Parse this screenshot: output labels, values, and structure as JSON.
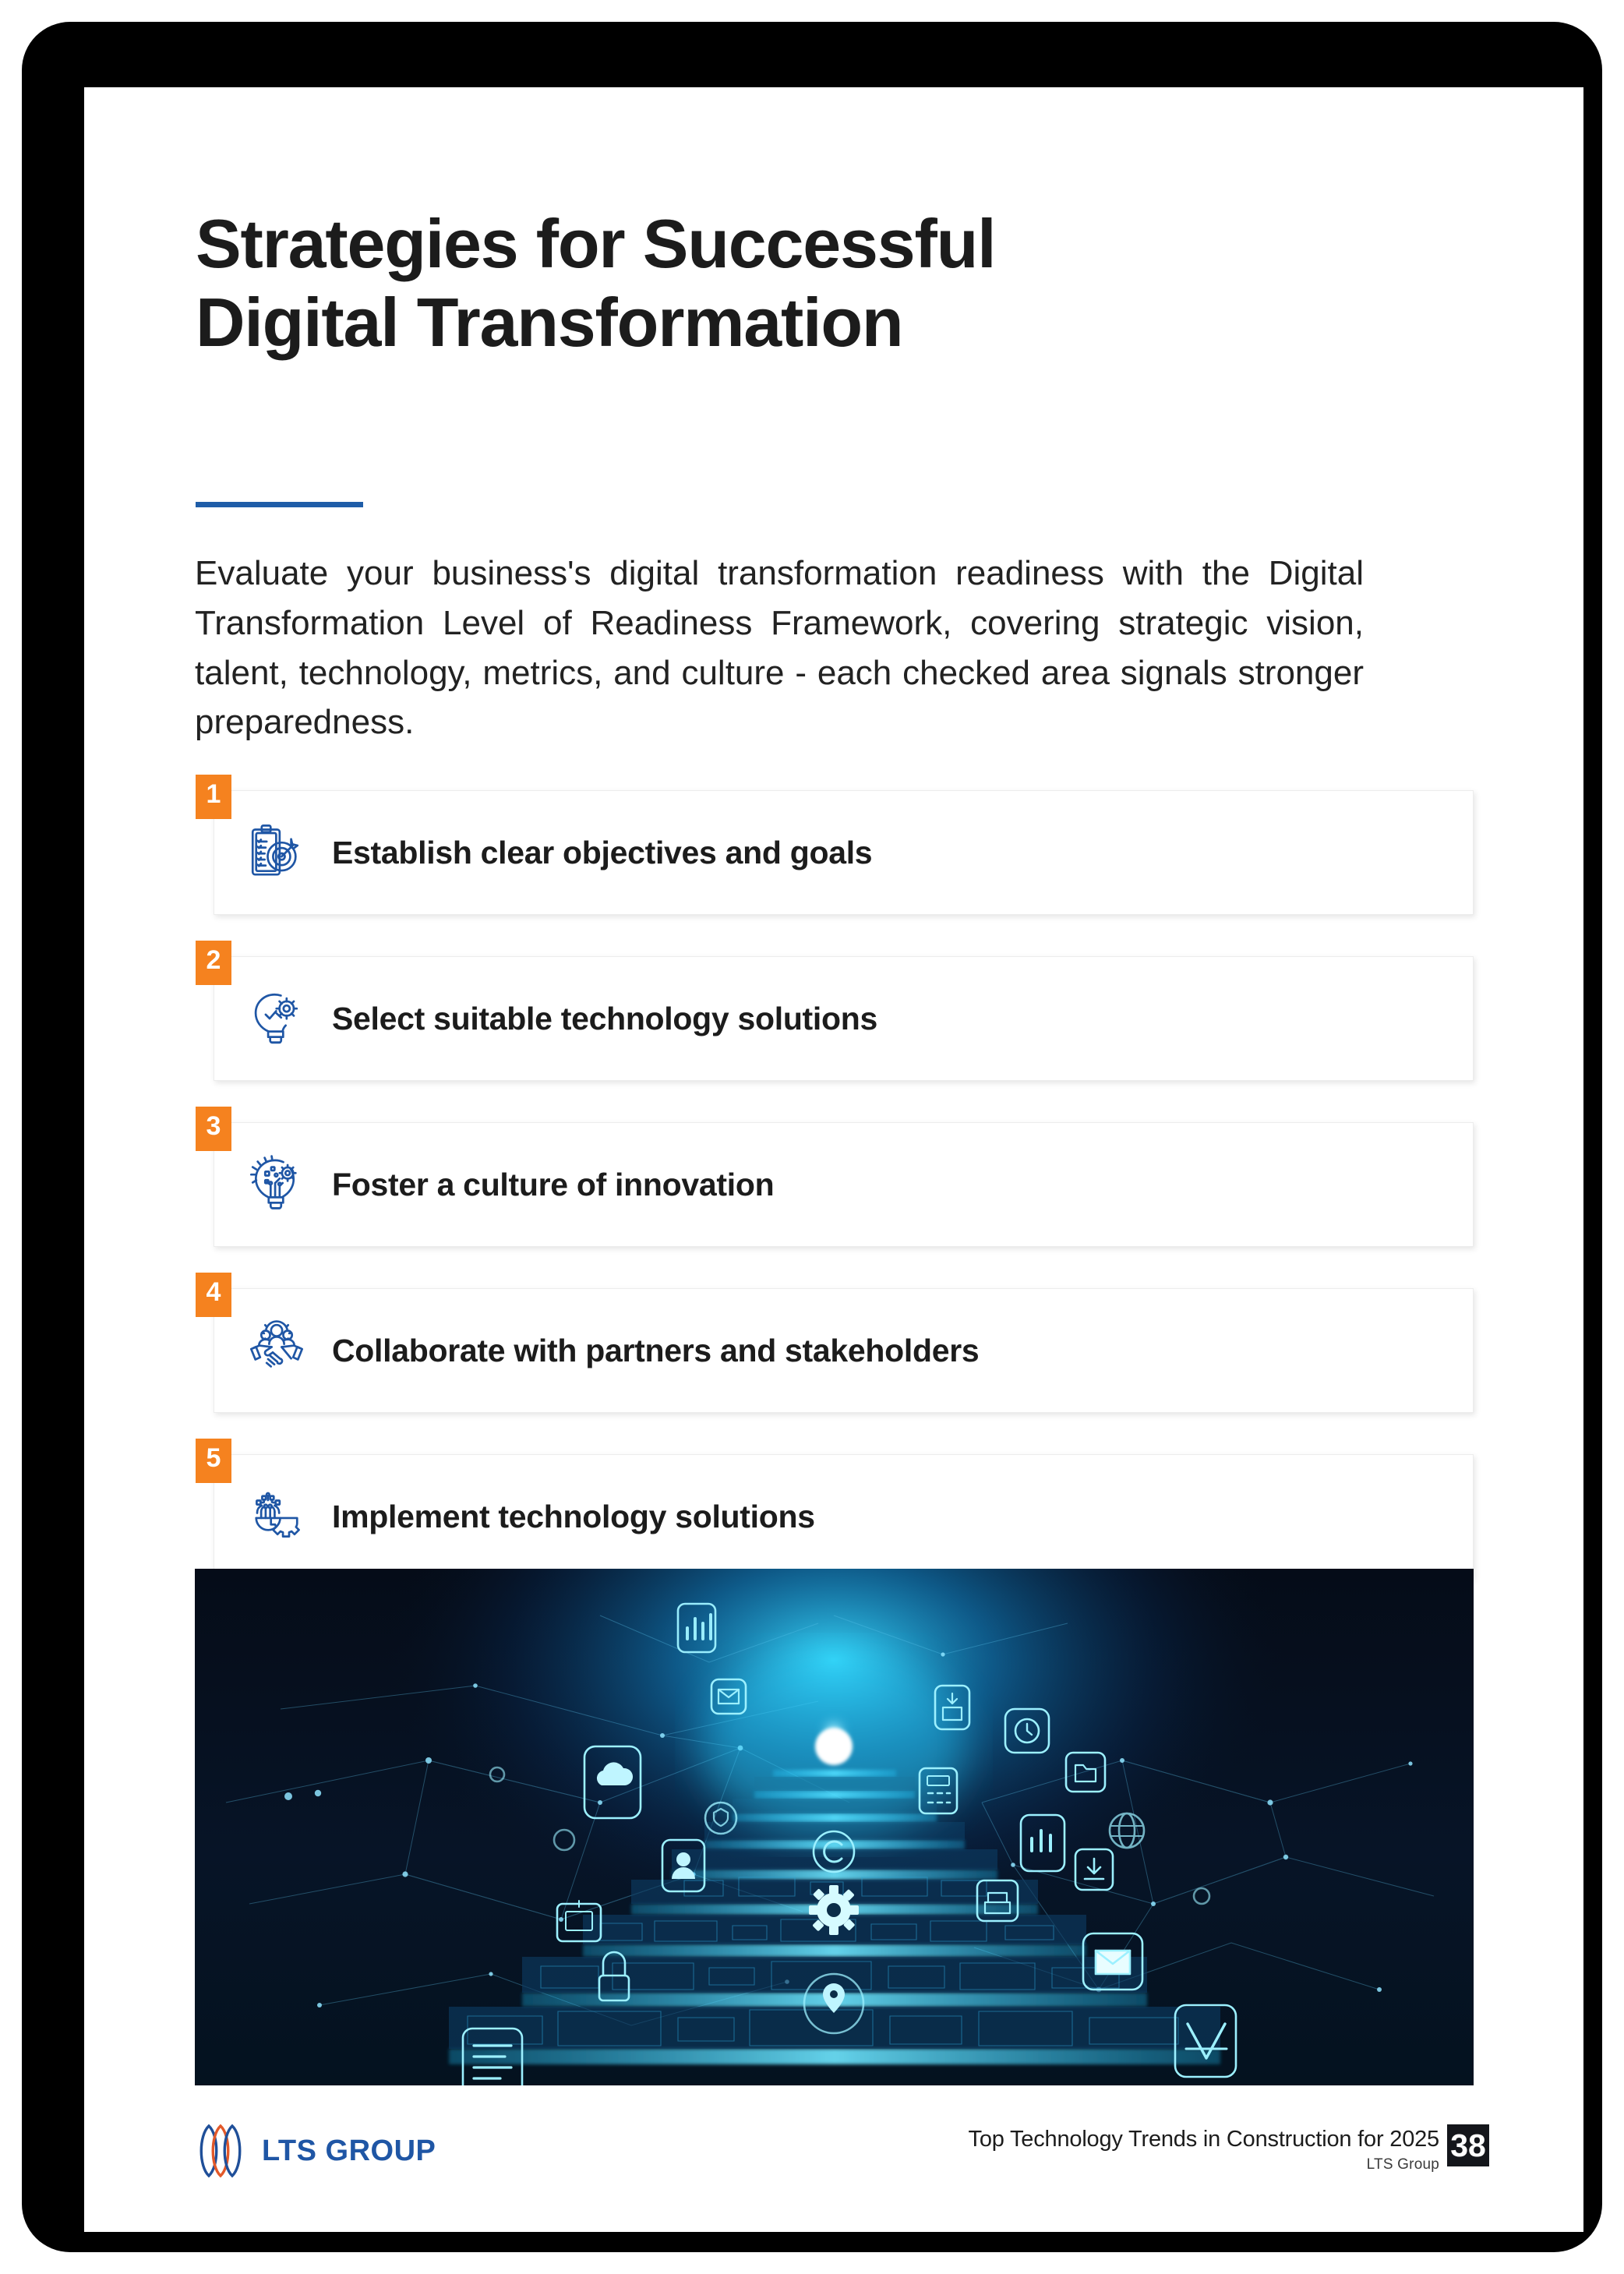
{
  "page": {
    "title": "Strategies for Successful\nDigital Transformation",
    "intro": "Evaluate your business's digital transformation readiness with the Digital Transformation Level of Readiness Framework, covering strategic vision, talent, technology, metrics, and culture - each checked area signals stronger preparedness.",
    "accent_blue": "#1f5da8",
    "accent_orange": "#f5821f",
    "rule_color": "#1f5da8"
  },
  "steps": [
    {
      "number": "1",
      "label": "Establish clear objectives and goals",
      "icon": "clipboard-target-icon"
    },
    {
      "number": "2",
      "label": "Select suitable technology solutions",
      "icon": "lightbulb-gear-icon"
    },
    {
      "number": "3",
      "label": "Foster a culture of innovation",
      "icon": "lightbulb-circuit-icon"
    },
    {
      "number": "4",
      "label": "Collaborate with partners and stakeholders",
      "icon": "handshake-team-icon"
    },
    {
      "number": "5",
      "label": "Implement technology solutions",
      "icon": "gear-circuit-icon"
    }
  ],
  "hero": {
    "alt": "Glowing blue digital staircase with floating technology app icons and network nodes",
    "background_color": "#070f1c",
    "glow_color": "#25d4ff",
    "icons": [
      "bar-chart-icon",
      "envelope-icon",
      "cloud-icon",
      "user-icon",
      "lock-icon",
      "document-icon",
      "gear-icon",
      "location-pin-icon",
      "copyright-icon",
      "printer-icon",
      "inbox-icon",
      "monitor-icon",
      "calculator-icon",
      "chart-card-icon",
      "checkmark-icon",
      "clock-icon"
    ]
  },
  "footer": {
    "brand_name": "LTS GROUP",
    "brand_mark": "lts-leaf-logo-icon",
    "doc_title": "Top Technology Trends in Construction for 2025",
    "company": "LTS Group",
    "page_number": "38"
  }
}
